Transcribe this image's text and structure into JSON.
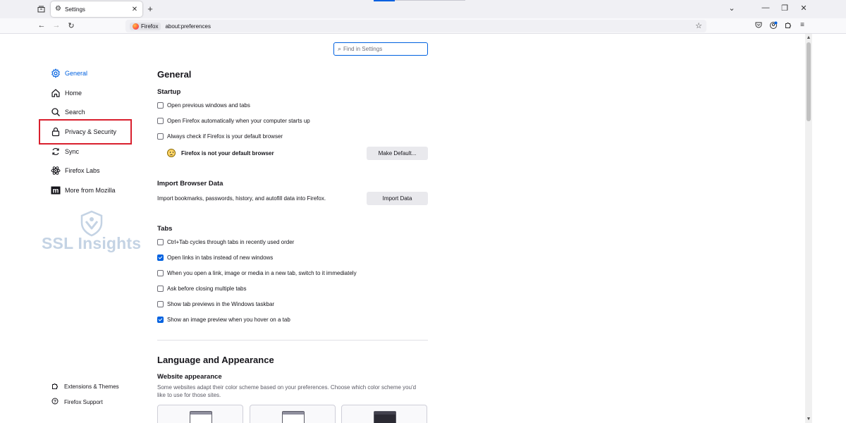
{
  "browser": {
    "tab": {
      "title": "Settings",
      "icon": "gear-icon"
    },
    "new_tab_label": "+",
    "window_controls": {
      "list_all_tabs": "list-all-tabs-icon",
      "dropdown": "⌄",
      "minimize": "—",
      "restore": "❐",
      "close": "✕"
    },
    "nav": {
      "back": "←",
      "forward": "→",
      "reload": "↻"
    },
    "url": {
      "identity_label": "Firefox",
      "address": "about:preferences",
      "bookmark_icon": "☆"
    },
    "toolbar": {
      "pocket": "pocket-icon",
      "account": "account-icon",
      "extensions": "extensions-icon",
      "menu": "≡"
    }
  },
  "search": {
    "placeholder": "Find in Settings",
    "value": ""
  },
  "sidebar": {
    "categories": [
      {
        "label": "General",
        "icon": "gear-icon",
        "selected": true
      },
      {
        "label": "Home",
        "icon": "home-icon",
        "selected": false
      },
      {
        "label": "Search",
        "icon": "search-icon",
        "selected": false
      },
      {
        "label": "Privacy & Security",
        "icon": "lock-icon",
        "selected": false,
        "highlighted": true
      },
      {
        "label": "Sync",
        "icon": "sync-icon",
        "selected": false
      },
      {
        "label": "Firefox Labs",
        "icon": "labs-icon",
        "selected": false
      },
      {
        "label": "More from Mozilla",
        "icon": "mozilla-icon",
        "selected": false
      }
    ],
    "footer": [
      {
        "label": "Extensions & Themes",
        "icon": "puzzle-icon"
      },
      {
        "label": "Firefox Support",
        "icon": "help-icon"
      }
    ],
    "watermark": "SSL Insights"
  },
  "main": {
    "title": "General",
    "startup": {
      "heading": "Startup",
      "options": [
        {
          "label": "Open previous windows and tabs",
          "checked": false
        },
        {
          "label": "Open Firefox automatically when your computer starts up",
          "checked": false
        },
        {
          "label": "Always check if Firefox is your default browser",
          "checked": false
        }
      ],
      "default_status": "Firefox is not your default browser",
      "make_default_button": "Make Default..."
    },
    "import": {
      "heading": "Import Browser Data",
      "description": "Import bookmarks, passwords, history, and autofill data into Firefox.",
      "button": "Import Data"
    },
    "tabs": {
      "heading": "Tabs",
      "options": [
        {
          "label": "Ctrl+Tab cycles through tabs in recently used order",
          "checked": false
        },
        {
          "label": "Open links in tabs instead of new windows",
          "checked": true
        },
        {
          "label": "When you open a link, image or media in a new tab, switch to it immediately",
          "checked": false
        },
        {
          "label": "Ask before closing multiple tabs",
          "checked": false
        },
        {
          "label": "Show tab previews in the Windows taskbar",
          "checked": false
        },
        {
          "label": "Show an image preview when you hover on a tab",
          "checked": true
        }
      ]
    },
    "language_appearance": {
      "heading": "Language and Appearance",
      "website_appearance": {
        "heading": "Website appearance",
        "description": "Some websites adapt their color scheme based on your preferences. Choose which color scheme you'd like to use for those sites."
      }
    }
  },
  "colors": {
    "accent": "#0061e0",
    "highlight_box": "#d9202e",
    "watermark": "#c4d3e4"
  }
}
